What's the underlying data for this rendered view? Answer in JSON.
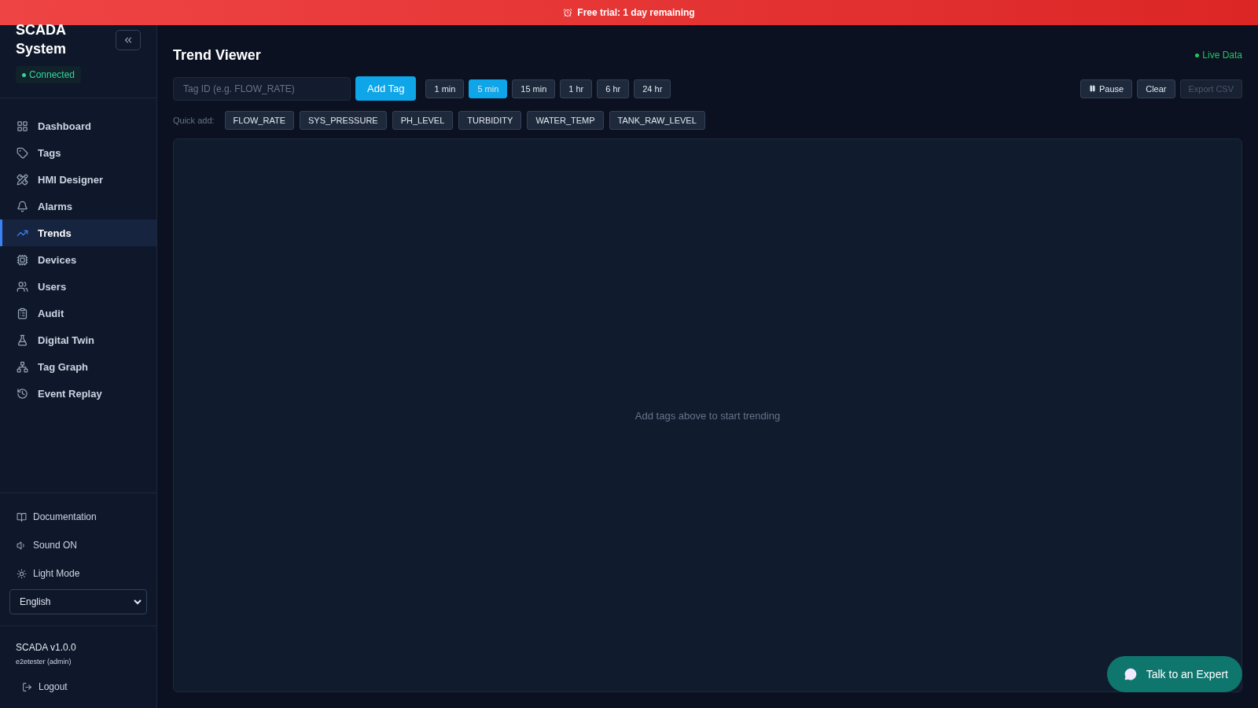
{
  "banner": {
    "text": "Free trial: 1 day remaining"
  },
  "sidebar": {
    "title": "SCADA System",
    "status": "Connected",
    "connected": true,
    "items": [
      {
        "label": "Dashboard",
        "selected": false
      },
      {
        "label": "Tags",
        "selected": false
      },
      {
        "label": "HMI Designer",
        "selected": false
      },
      {
        "label": "Alarms",
        "selected": false
      },
      {
        "label": "Trends",
        "selected": true
      },
      {
        "label": "Devices",
        "selected": false
      },
      {
        "label": "Users",
        "selected": false
      },
      {
        "label": "Audit",
        "selected": false
      },
      {
        "label": "Digital Twin",
        "selected": false
      },
      {
        "label": "Tag Graph",
        "selected": false
      },
      {
        "label": "Event Replay",
        "selected": false
      }
    ],
    "footer_links": [
      "Documentation",
      "Sound ON",
      "Light Mode"
    ],
    "language": "English",
    "version": "SCADA v1.0.0",
    "user": "e2etester (admin)",
    "logout": "Logout"
  },
  "main": {
    "title": "Trend Viewer",
    "live": "Live Data",
    "tag_input": {
      "placeholder": "Tag ID (e.g. FLOW_RATE)"
    },
    "add_button": "Add Tag",
    "ranges": [
      {
        "label": "1 min",
        "selected": false
      },
      {
        "label": "5 min",
        "selected": true
      },
      {
        "label": "15 min",
        "selected": false
      },
      {
        "label": "1 hr",
        "selected": false
      },
      {
        "label": "6 hr",
        "selected": false
      },
      {
        "label": "24 hr",
        "selected": false
      }
    ],
    "actions": [
      {
        "label": "Pause",
        "kind": "pause",
        "disabled": false
      },
      {
        "label": "Clear",
        "kind": "plain",
        "disabled": false
      },
      {
        "label": "Export CSV",
        "kind": "plain",
        "disabled": true
      }
    ],
    "quick_add_label": "Quick add:",
    "quick_tags": [
      "FLOW_RATE",
      "SYS_PRESSURE",
      "PH_LEVEL",
      "TURBIDITY",
      "WATER_TEMP",
      "TANK_RAW_LEVEL"
    ],
    "empty_message": "Add tags above to start trending"
  },
  "chat_button": "Talk to an Expert"
}
